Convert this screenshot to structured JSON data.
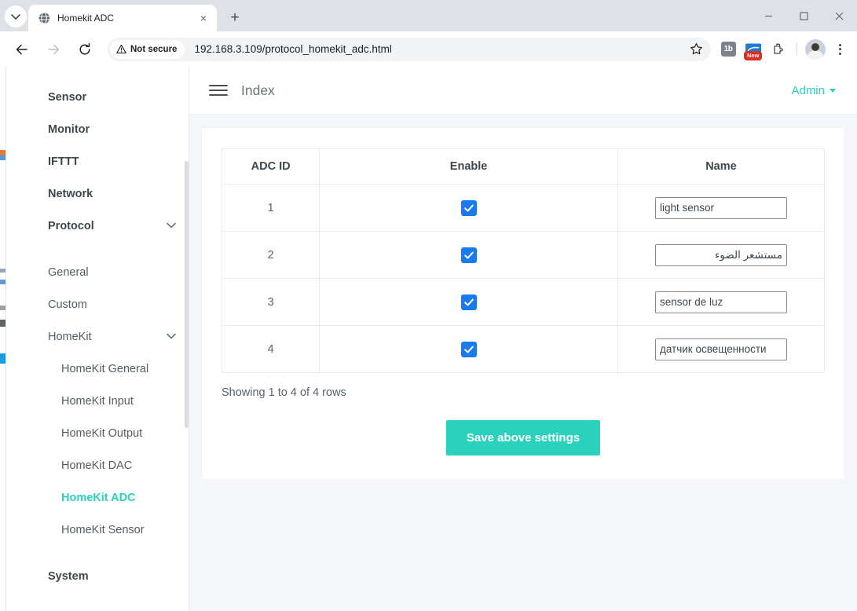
{
  "browser": {
    "tab": {
      "title": "Homekit ADC",
      "favicon": "globe-icon",
      "close": "×"
    },
    "new_tab_label": "+",
    "security_label": "Not secure",
    "url": "192.168.3.109/protocol_homekit_adc.html",
    "extensions": [
      {
        "name": "onebrand-extension-icon",
        "label": "1b"
      },
      {
        "name": "screenshot-extension-icon",
        "badge": "New"
      }
    ],
    "window_controls": {
      "minimize": "minimize-icon",
      "maximize": "maximize-icon",
      "close": "close-icon"
    }
  },
  "sidebar": {
    "items": [
      {
        "label": "Sensor",
        "level": "top",
        "active": false,
        "chevron": false
      },
      {
        "label": "Monitor",
        "level": "top",
        "active": false,
        "chevron": false
      },
      {
        "label": "IFTTT",
        "level": "top",
        "active": false,
        "chevron": false
      },
      {
        "label": "Network",
        "level": "top",
        "active": false,
        "chevron": false
      },
      {
        "label": "Protocol",
        "level": "top",
        "active": false,
        "chevron": true
      },
      {
        "label": "General",
        "level": "sub",
        "active": false,
        "chevron": false
      },
      {
        "label": "Custom",
        "level": "sub",
        "active": false,
        "chevron": false
      },
      {
        "label": "HomeKit",
        "level": "sub",
        "active": false,
        "chevron": true
      },
      {
        "label": "HomeKit General",
        "level": "sub2",
        "active": false,
        "chevron": false
      },
      {
        "label": "HomeKit Input",
        "level": "sub2",
        "active": false,
        "chevron": false
      },
      {
        "label": "HomeKit Output",
        "level": "sub2",
        "active": false,
        "chevron": false
      },
      {
        "label": "HomeKit DAC",
        "level": "sub2",
        "active": false,
        "chevron": false
      },
      {
        "label": "HomeKit ADC",
        "level": "sub2",
        "active": true,
        "chevron": false
      },
      {
        "label": "HomeKit Sensor",
        "level": "sub2",
        "active": false,
        "chevron": false
      },
      {
        "label": "System",
        "level": "top",
        "active": false,
        "chevron": false
      }
    ]
  },
  "topbar": {
    "menu_icon": "hamburger-icon",
    "title": "Index",
    "account_label": "Admin"
  },
  "table": {
    "headers": [
      "ADC ID",
      "Enable",
      "Name"
    ],
    "rows": [
      {
        "id": "1",
        "enabled": true,
        "name": "light sensor",
        "rtl": false
      },
      {
        "id": "2",
        "enabled": true,
        "name": "مستشعر الضوء",
        "rtl": true
      },
      {
        "id": "3",
        "enabled": true,
        "name": "sensor de luz",
        "rtl": false
      },
      {
        "id": "4",
        "enabled": true,
        "name": "датчик освещенности",
        "rtl": false
      }
    ],
    "showing_text": "Showing 1 to 4 of 4 rows"
  },
  "actions": {
    "save_label": "Save above settings"
  },
  "colors": {
    "accent_teal": "#2bd2bb",
    "checkbox_blue": "#1a7aef",
    "page_bg": "#f4f6f9",
    "border": "#e9ecef"
  }
}
